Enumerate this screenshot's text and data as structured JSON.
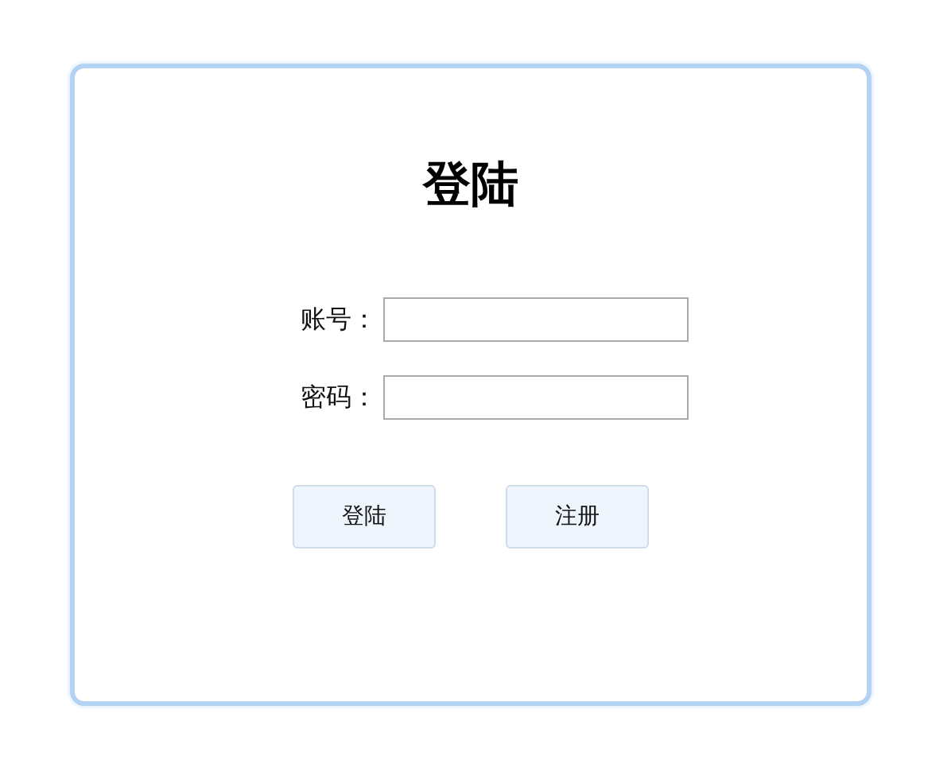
{
  "title": "登陆",
  "fields": [
    {
      "label": "账号："
    },
    {
      "label": "密码："
    }
  ],
  "buttons": [
    "登陆",
    "注册"
  ]
}
